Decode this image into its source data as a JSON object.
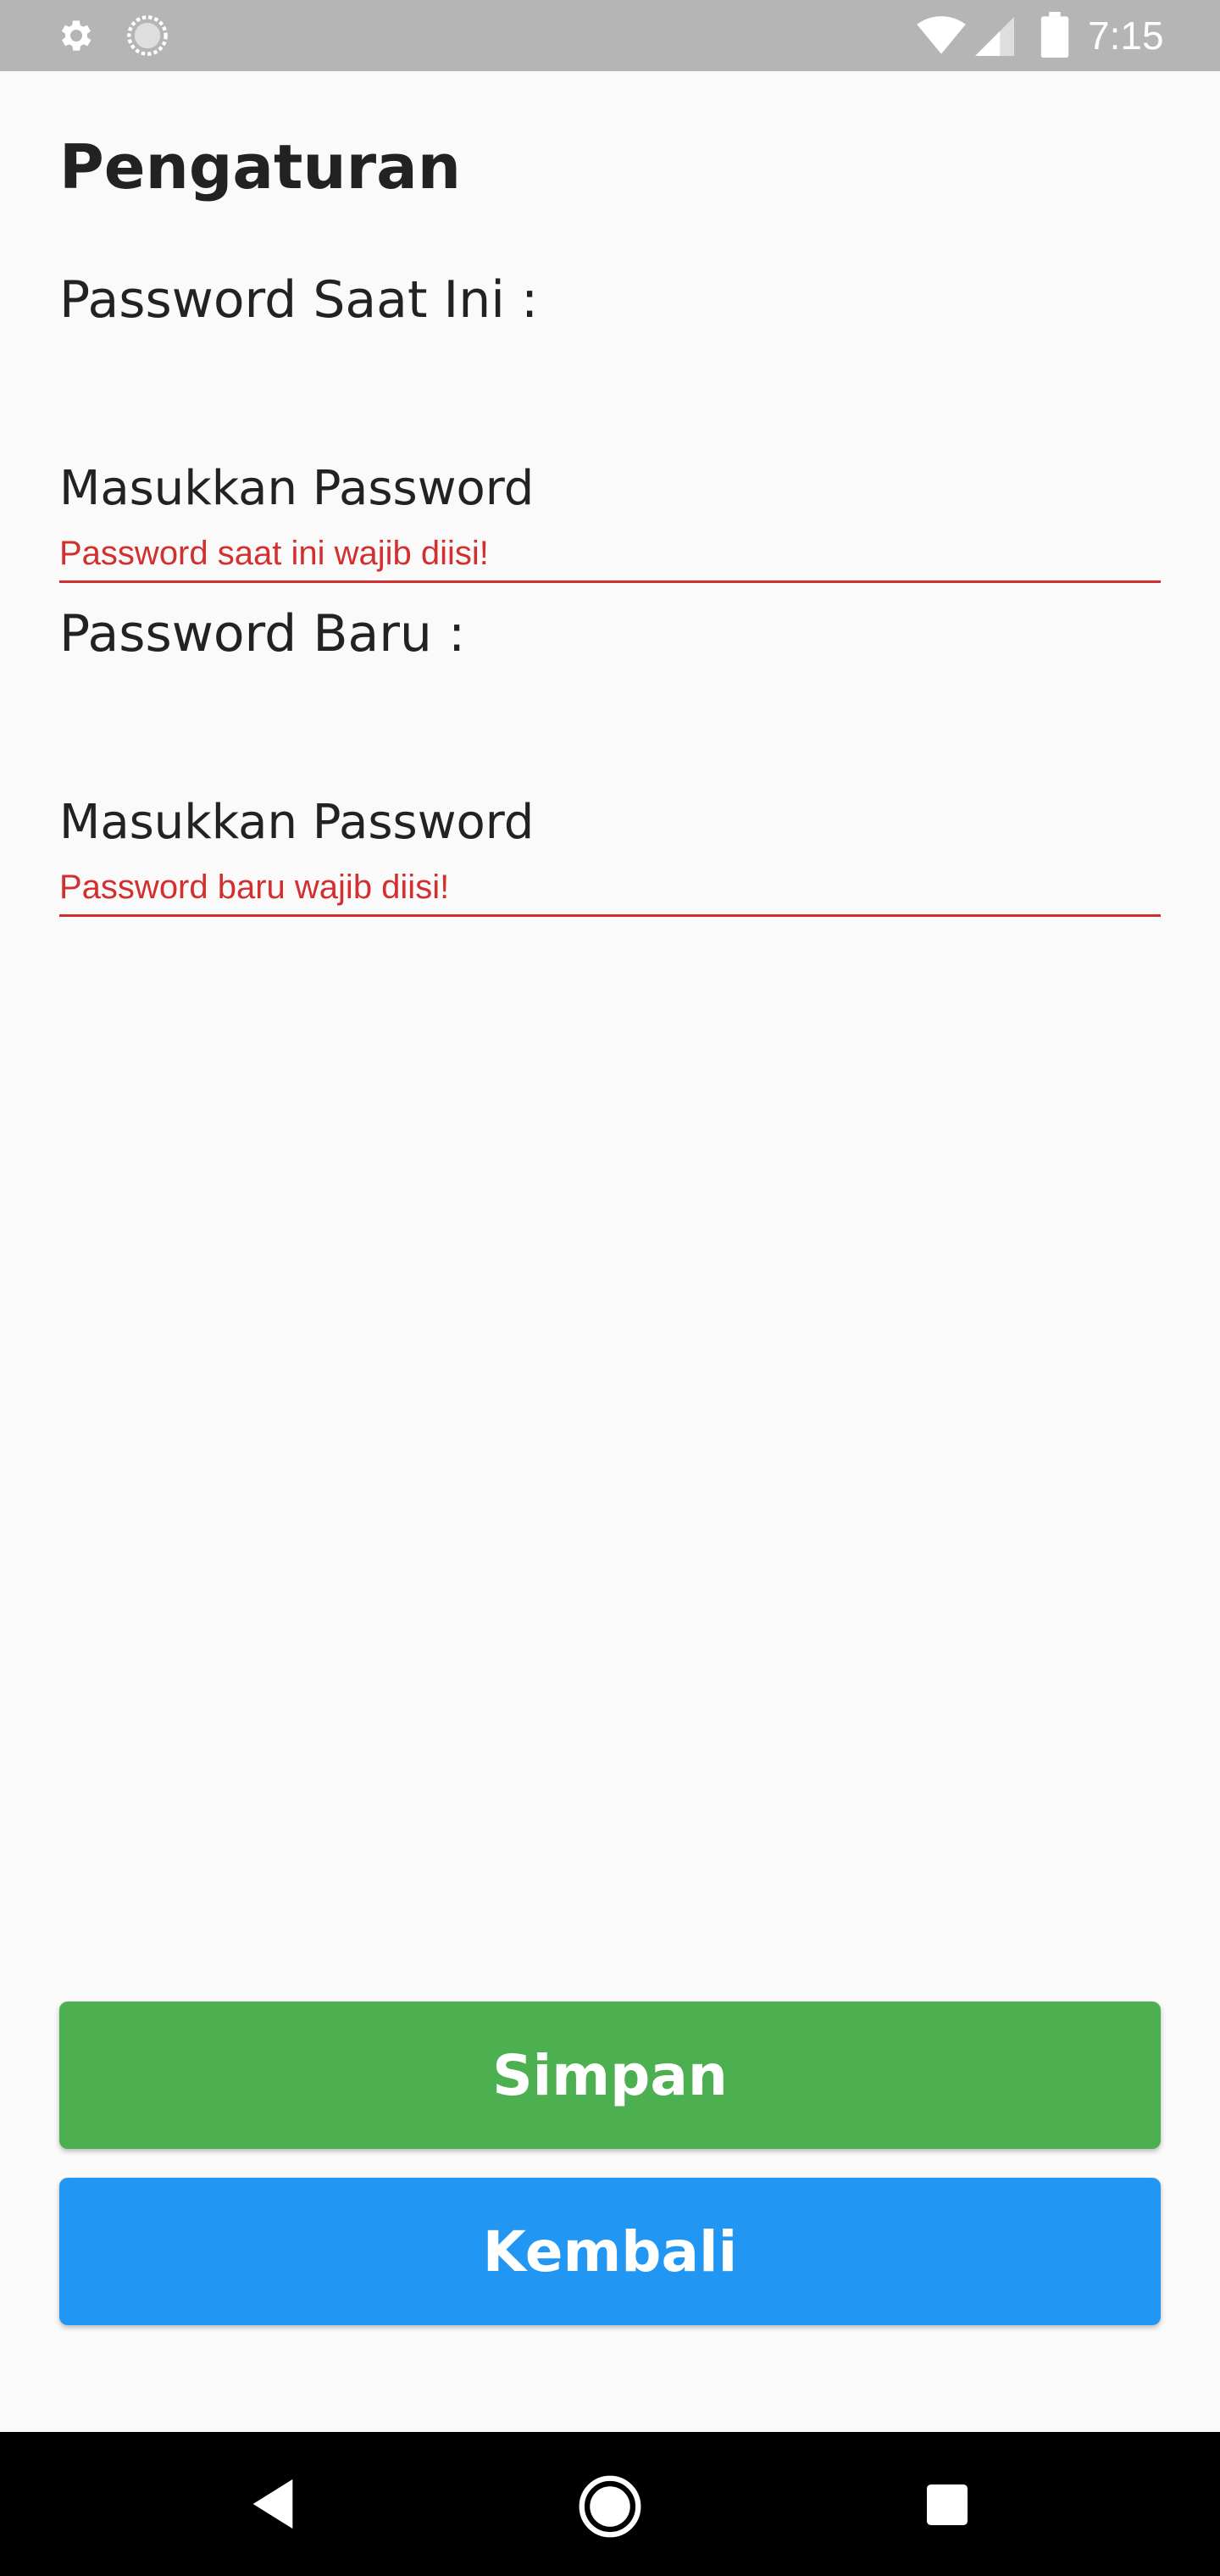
{
  "status_bar": {
    "time": "7:15",
    "icons": [
      "gear-icon",
      "sync-icon",
      "wifi-icon",
      "signal-icon",
      "battery-icon"
    ]
  },
  "page": {
    "title": "Pengaturan"
  },
  "form": {
    "current_password": {
      "label": "Password Saat Ini :",
      "placeholder": "Masukkan Password",
      "value": "",
      "error": "Password saat ini wajib diisi!"
    },
    "new_password": {
      "label": "Password Baru :",
      "placeholder": "Masukkan Password",
      "value": "",
      "error": "Password baru wajib diisi!"
    }
  },
  "buttons": {
    "save_label": "Simpan",
    "back_label": "Kembali"
  },
  "colors": {
    "status_bar": "#b5b5b5",
    "background": "#fafafa",
    "error": "#d32f2f",
    "save_button": "#4caf50",
    "back_button": "#2196f3",
    "nav_bar": "#000000"
  },
  "nav_bar": {
    "icons": [
      "back-icon",
      "home-icon",
      "recents-icon"
    ]
  }
}
